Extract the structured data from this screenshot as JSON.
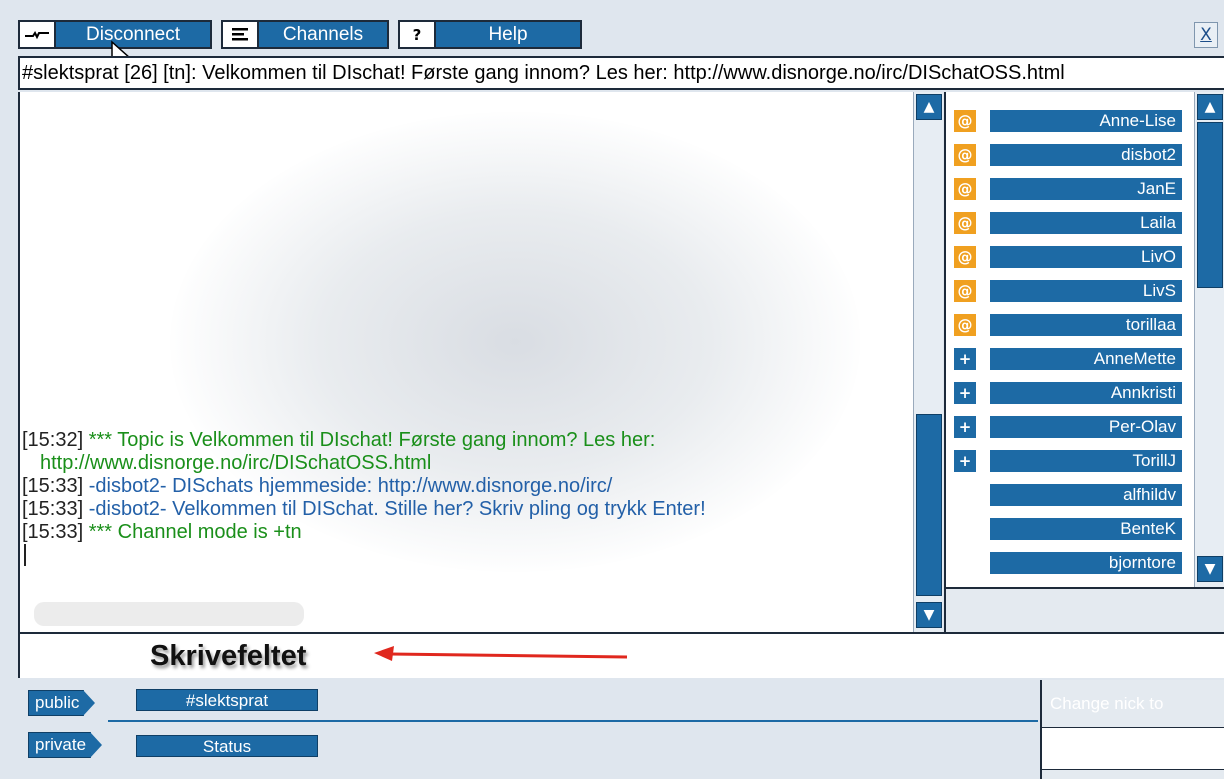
{
  "toolbar": {
    "disconnect_label": "Disconnect",
    "channels_label": "Channels",
    "help_label": "Help",
    "close_label": "X",
    "help_icon": "?"
  },
  "topic": "#slektsprat [26] [tn]: Velkommen til DIschat! Første gang innom? Les her: http://www.disnorge.no/irc/DISchatOSS.html",
  "chat": {
    "messages": [
      {
        "time": "[15:32]",
        "prefix": "***",
        "text": "Topic is Velkommen til DIschat! Første gang innom? Les her: http://www.disnorge.no/irc/DISchatOSS.html",
        "color": "#1a8f1a"
      },
      {
        "time": "[15:33]",
        "prefix": "",
        "text": "-disbot2- DISchats hjemmeside: http://www.disnorge.no/irc/",
        "color": "#2360a8"
      },
      {
        "time": "[15:33]",
        "prefix": "",
        "text": "-disbot2- Velkommen til DISchat. Stille her? Skriv pling og trykk Enter!",
        "color": "#2360a8"
      },
      {
        "time": "[15:33]",
        "prefix": "***",
        "text": "Channel mode is +tn",
        "color": "#1a8f1a"
      }
    ]
  },
  "users": [
    {
      "mode": "op",
      "badge": "@",
      "name": "Anne-Lise"
    },
    {
      "mode": "op",
      "badge": "@",
      "name": "disbot2"
    },
    {
      "mode": "op",
      "badge": "@",
      "name": "JanE"
    },
    {
      "mode": "op",
      "badge": "@",
      "name": "Laila"
    },
    {
      "mode": "op",
      "badge": "@",
      "name": "LivO"
    },
    {
      "mode": "op",
      "badge": "@",
      "name": "LivS"
    },
    {
      "mode": "op",
      "badge": "@",
      "name": "torillaa"
    },
    {
      "mode": "voice",
      "badge": "+",
      "name": "AnneMette"
    },
    {
      "mode": "voice",
      "badge": "+",
      "name": "Annkristi"
    },
    {
      "mode": "voice",
      "badge": "+",
      "name": "Per-Olav"
    },
    {
      "mode": "voice",
      "badge": "+",
      "name": "TorillJ"
    },
    {
      "mode": "none",
      "badge": "",
      "name": "alfhildv"
    },
    {
      "mode": "none",
      "badge": "",
      "name": "BenteK"
    },
    {
      "mode": "none",
      "badge": "",
      "name": "bjorntore"
    }
  ],
  "input": {
    "annotation": "Skrivefeltet",
    "value": ""
  },
  "tabs": {
    "public_label": "public",
    "private_label": "private",
    "public_channel": "#slektsprat",
    "private_channel": "Status"
  },
  "nick": {
    "label": "Change nick to",
    "value": ""
  },
  "colors": {
    "accent": "#1d6aa5",
    "op_badge": "#f0a020",
    "system_text": "#1a8f1a",
    "notice_text": "#2360a8"
  }
}
